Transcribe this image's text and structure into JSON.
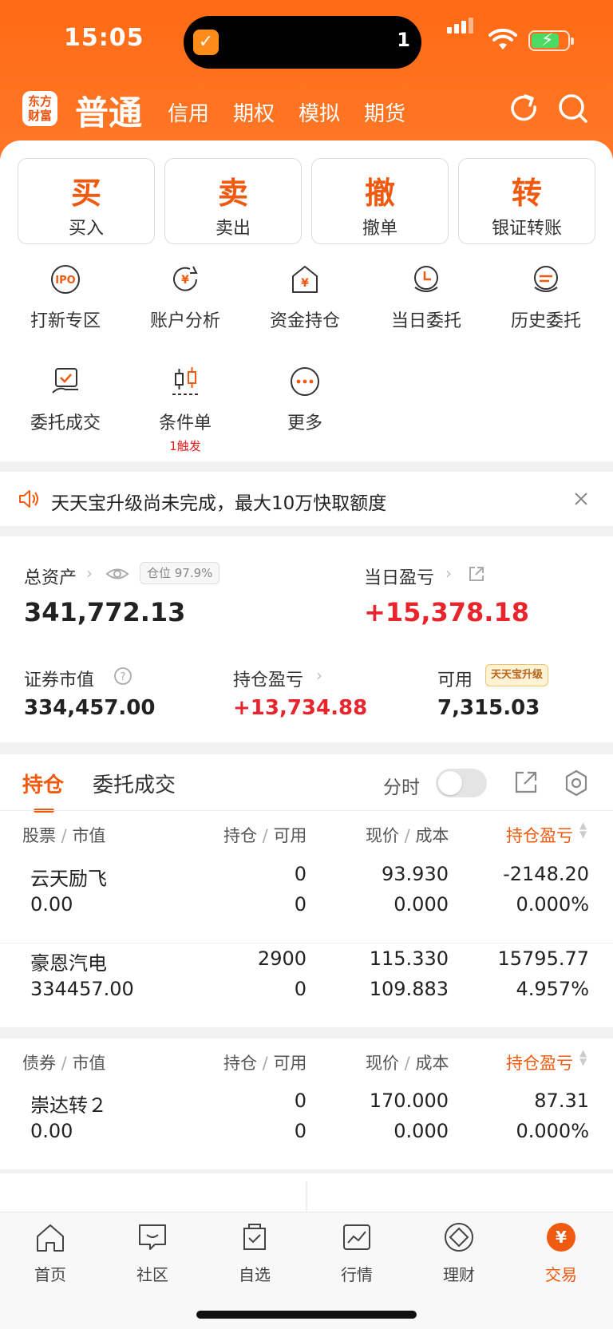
{
  "status_bar": {
    "time": "15:05",
    "notification_count": "1"
  },
  "header": {
    "logo": "东方财富",
    "active_tab": "普通",
    "tabs": [
      "信用",
      "期权",
      "模拟",
      "期货"
    ]
  },
  "actions": [
    {
      "char": "买",
      "label": "买入"
    },
    {
      "char": "卖",
      "label": "卖出"
    },
    {
      "char": "撤",
      "label": "撤单"
    },
    {
      "char": "转",
      "label": "银证转账"
    }
  ],
  "functions": [
    {
      "label": "打新专区",
      "icon": "ipo-icon"
    },
    {
      "label": "账户分析",
      "icon": "analysis-icon"
    },
    {
      "label": "资金持仓",
      "icon": "funds-icon"
    },
    {
      "label": "当日委托",
      "icon": "today-order-icon"
    },
    {
      "label": "历史委托",
      "icon": "history-order-icon"
    },
    {
      "label": "委托成交",
      "icon": "deal-icon"
    },
    {
      "label": "条件单",
      "icon": "condition-icon",
      "sub": "1触发"
    },
    {
      "label": "更多",
      "icon": "more-icon"
    }
  ],
  "notice": {
    "text": "天天宝升级尚未完成，最大10万快取额度"
  },
  "assets": {
    "total_label": "总资产",
    "position_pill": "仓位 97.9%",
    "total_value": "341,772.13",
    "daily_label": "当日盈亏",
    "daily_value": "+15,378.18",
    "market_label": "证券市值",
    "market_value": "334,457.00",
    "holding_pl_label": "持仓盈亏",
    "holding_pl_value": "+13,734.88",
    "available_label": "可用",
    "available_badge": "天天宝升级",
    "available_value": "7,315.03"
  },
  "positions": {
    "tabs": [
      "持仓",
      "委托成交"
    ],
    "toggle_label": "分时",
    "stock_header": {
      "name": "股票",
      "name2": "市值",
      "qty": "持仓",
      "qty2": "可用",
      "price": "现价",
      "price2": "成本",
      "pl": "持仓盈亏"
    },
    "stocks": [
      {
        "name": "云天励飞",
        "mv": "0.00",
        "hold": "0",
        "avail": "0",
        "price": "93.930",
        "cost": "0.000",
        "pl": "-2148.20",
        "pct": "0.000%",
        "color": "#1aa33a"
      },
      {
        "name": "豪恩汽电",
        "mv": "334457.00",
        "hold": "2900",
        "avail": "0",
        "price": "115.330",
        "cost": "109.883",
        "pl": "15795.77",
        "pct": "4.957%",
        "color": "#e8242c"
      }
    ],
    "bond_header": {
      "name": "债券",
      "name2": "市值",
      "qty": "持仓",
      "qty2": "可用",
      "price": "现价",
      "price2": "成本",
      "pl": "持仓盈亏"
    },
    "bonds": [
      {
        "name": "崇达转２",
        "mv": "0.00",
        "hold": "0",
        "avail": "0",
        "price": "170.000",
        "cost": "0.000",
        "pl": "87.31",
        "pct": "0.000%",
        "color": "#e8242c"
      }
    ]
  },
  "tabbar": [
    {
      "label": "首页",
      "icon": "home-icon"
    },
    {
      "label": "社区",
      "icon": "community-icon"
    },
    {
      "label": "自选",
      "icon": "watchlist-icon"
    },
    {
      "label": "行情",
      "icon": "market-icon"
    },
    {
      "label": "理财",
      "icon": "wealth-icon"
    },
    {
      "label": "交易",
      "icon": "trade-icon",
      "active": true
    }
  ],
  "colors": {
    "accent": "#ef5a10",
    "up": "#e8242c",
    "down": "#1aa33a"
  }
}
